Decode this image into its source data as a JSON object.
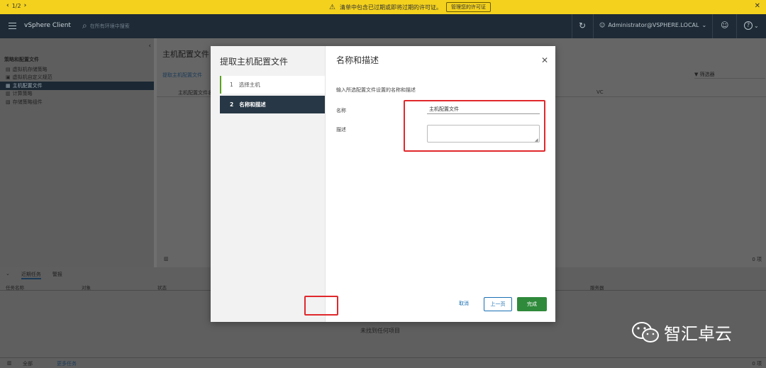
{
  "notification": {
    "pager": "1/2",
    "message": "清单中包含已过期或即将过期的许可证。",
    "manage_button": "管理您的许可证"
  },
  "header": {
    "brand": "vSphere Client",
    "search_placeholder": "在所有环境中搜索",
    "user": "Administrator@VSPHERE.LOCAL"
  },
  "sidebar": {
    "section": "策略和配置文件",
    "items": [
      {
        "label": "虚拟机存储策略",
        "icon": "policy-icon"
      },
      {
        "label": "虚拟机自定义规范",
        "icon": "customization-icon"
      },
      {
        "label": "主机配置文件",
        "icon": "host-profile-icon",
        "active": true
      },
      {
        "label": "计算策略",
        "icon": "compute-policy-icon"
      },
      {
        "label": "存储策略组件",
        "icon": "storage-component-icon"
      }
    ]
  },
  "main": {
    "title": "主机配置文件",
    "extract_link": "提取主机配置文件",
    "filter_placeholder": "筛选器",
    "columns": [
      "主机配置文件名",
      "VC"
    ],
    "count": "0 项"
  },
  "bottom": {
    "tabs": [
      "近期任务",
      "警报"
    ],
    "columns": [
      "任务名称",
      "对象",
      "状态",
      "服务器"
    ],
    "empty": "未找到任何项目",
    "footer_all": "全部",
    "footer_more": "更多任务",
    "footer_count": "0 项"
  },
  "modal": {
    "wizard_title": "提取主机配置文件",
    "steps": [
      {
        "num": "1",
        "label": "选择主机"
      },
      {
        "num": "2",
        "label": "名称和描述"
      }
    ],
    "step_title": "名称和描述",
    "instruction": "输入所选配置文件设置的名称和描述",
    "name_label": "名称",
    "name_value": "主机配置文件",
    "desc_label": "描述",
    "desc_value": "",
    "cancel": "取消",
    "prev": "上一页",
    "finish": "完成"
  },
  "watermark": {
    "text": "智汇卓云"
  },
  "colors": {
    "notification": "#f3d11d",
    "header": "#1e2a35",
    "active_step": "#273745",
    "finish_button": "#2f8a3b",
    "highlight": "#e0282c",
    "link": "#1a6fb3"
  }
}
